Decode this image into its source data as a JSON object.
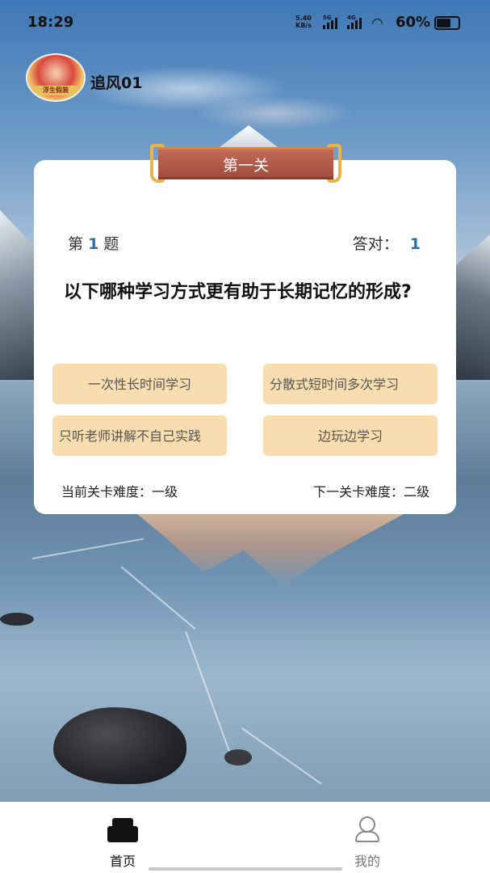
{
  "status_bar": {
    "time": "18:29",
    "speed_value": "5.40",
    "speed_unit": "KB/s",
    "net1": "5G",
    "net2": "4G",
    "battery": "60%"
  },
  "user": {
    "name": "追风01",
    "avatar_caption": "浮生假装"
  },
  "level": {
    "title": "第一关"
  },
  "quiz": {
    "question_prefix": "第",
    "question_number": "1",
    "question_suffix": "题",
    "correct_label": "答对：",
    "correct_count": "1",
    "question": "以下哪种学习方式更有助于长期记忆的形成?",
    "options": [
      "一次性长时间学习",
      "分散式短时间多次学习",
      "只听老师讲解不自己实践",
      "边玩边学习"
    ],
    "current_difficulty": "当前关卡难度：一级",
    "next_difficulty": "下一关卡难度：二级"
  },
  "nav": {
    "items": [
      {
        "label": "首页",
        "icon": "home-icon",
        "active": true
      },
      {
        "label": "我的",
        "icon": "user-icon",
        "active": false
      }
    ]
  },
  "colors": {
    "accent_number": "#2b6fa8",
    "option_bg": "#f8ddb0",
    "ribbon": "#a24d3e",
    "ribbon_trim": "#e9b54a"
  }
}
